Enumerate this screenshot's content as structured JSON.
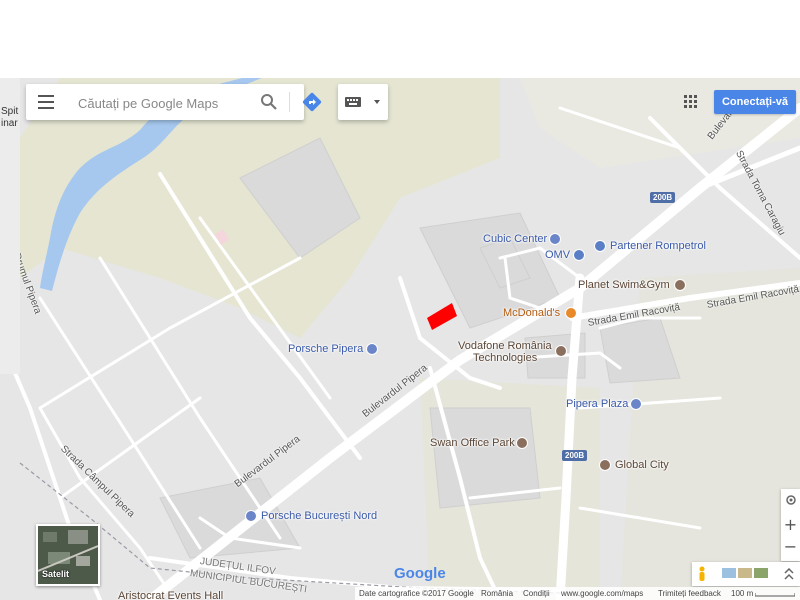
{
  "search": {
    "placeholder": "Căutați pe Google Maps"
  },
  "header": {
    "sign_in_label": "Conectați-vă"
  },
  "map": {
    "left_edge_text": [
      "Spit",
      "inar"
    ],
    "places": [
      {
        "name": "Cubic Center",
        "kind": "shop",
        "icon": "shopping-icon"
      },
      {
        "name": "Partener Rompetrol",
        "kind": "gas",
        "icon": "gas-station-icon"
      },
      {
        "name": "OMV",
        "kind": "gas",
        "icon": "gas-station-icon"
      },
      {
        "name": "Planet Swim&Gym",
        "kind": "place",
        "icon": "place-icon"
      },
      {
        "name": "McDonald's",
        "kind": "food",
        "icon": "restaurant-icon"
      },
      {
        "name": "Vodafone România",
        "kind": "place",
        "icon": "place-icon"
      },
      {
        "name": "Technologies",
        "kind": "place",
        "icon": "place-icon"
      },
      {
        "name": "Porsche Pipera",
        "kind": "shop",
        "icon": "shopping-icon"
      },
      {
        "name": "Pipera Plaza",
        "kind": "shop",
        "icon": "shopping-icon"
      },
      {
        "name": "Swan Office Park",
        "kind": "place",
        "icon": "place-icon"
      },
      {
        "name": "Global City",
        "kind": "place",
        "icon": "place-icon"
      },
      {
        "name": "Porsche București Nord",
        "kind": "shop",
        "icon": "shopping-icon"
      },
      {
        "name": "Aristocrat Events Hall",
        "kind": "place",
        "icon": "place-icon"
      }
    ],
    "streets": {
      "bulevardul_pipera_1": "Bulevardul Pipera",
      "bulevardul_pipera_2": "Bulevardul Pipera",
      "strada_campul_pipera": "Strada Câmpul Pipera",
      "drumul_pipera": "Drumul Pipera",
      "strada_emil_racovita_1": "Strada Emil Racoviță",
      "strada_emil_racovita_2": "Strada Emil Racoviță",
      "strada_toma_caragiu": "Strada Toma Caragiu",
      "bulevardul_top": "Bulevard",
      "judetul_ilfov": "JUDEȚUL ILFOV",
      "municipiul": "MUNICIPIUL BUCUREȘTI"
    },
    "route_shields": [
      "200B",
      "200B"
    ]
  },
  "controls": {
    "satellite_label": "Satelit",
    "zoom_in": "+",
    "zoom_out": "−"
  },
  "footer": {
    "map_data": "Date cartografice ©2017 Google",
    "country": "România",
    "terms": "Condiții",
    "url": "www.google.com/maps",
    "feedback": "Trimiteți feedback",
    "scale": "100 m"
  },
  "brand": {
    "logo_text": "Google"
  },
  "colors": {
    "land": "#e8e8e8",
    "block": "#dcdcdc",
    "green": "#e6e6cf",
    "water": "#a6c8ee",
    "road": "#ffffff",
    "accent": "#4a86e8",
    "highlight": "#ff0000"
  }
}
